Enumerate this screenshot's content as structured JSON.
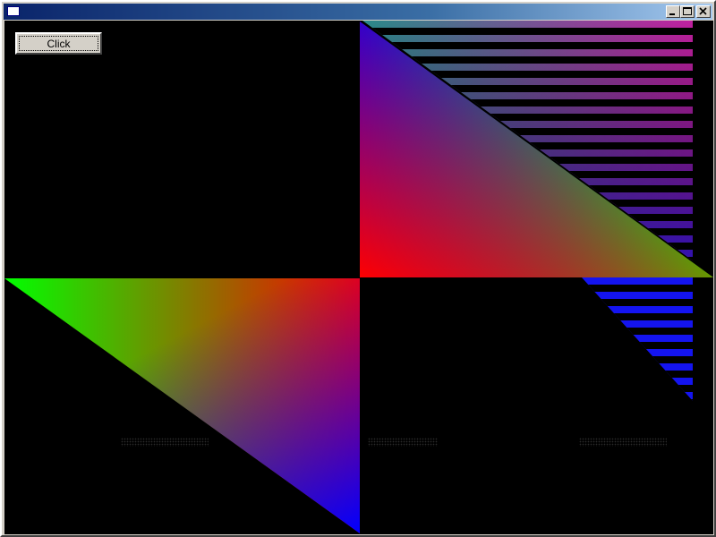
{
  "window": {
    "title": "",
    "controls": {
      "minimize": "minimize-icon",
      "maximize": "maximize-icon",
      "close": "close-icon"
    }
  },
  "client": {
    "background": "#000000",
    "button_label": "Click"
  },
  "colors": {
    "red": "#ff0000",
    "green": "#00ff00",
    "blue": "#0000ff",
    "teal_stripe": "#2a8a8a",
    "magenta_stripe": "#c020a0",
    "titlebar_start": "#0a246a",
    "titlebar_end": "#a6caf0"
  }
}
